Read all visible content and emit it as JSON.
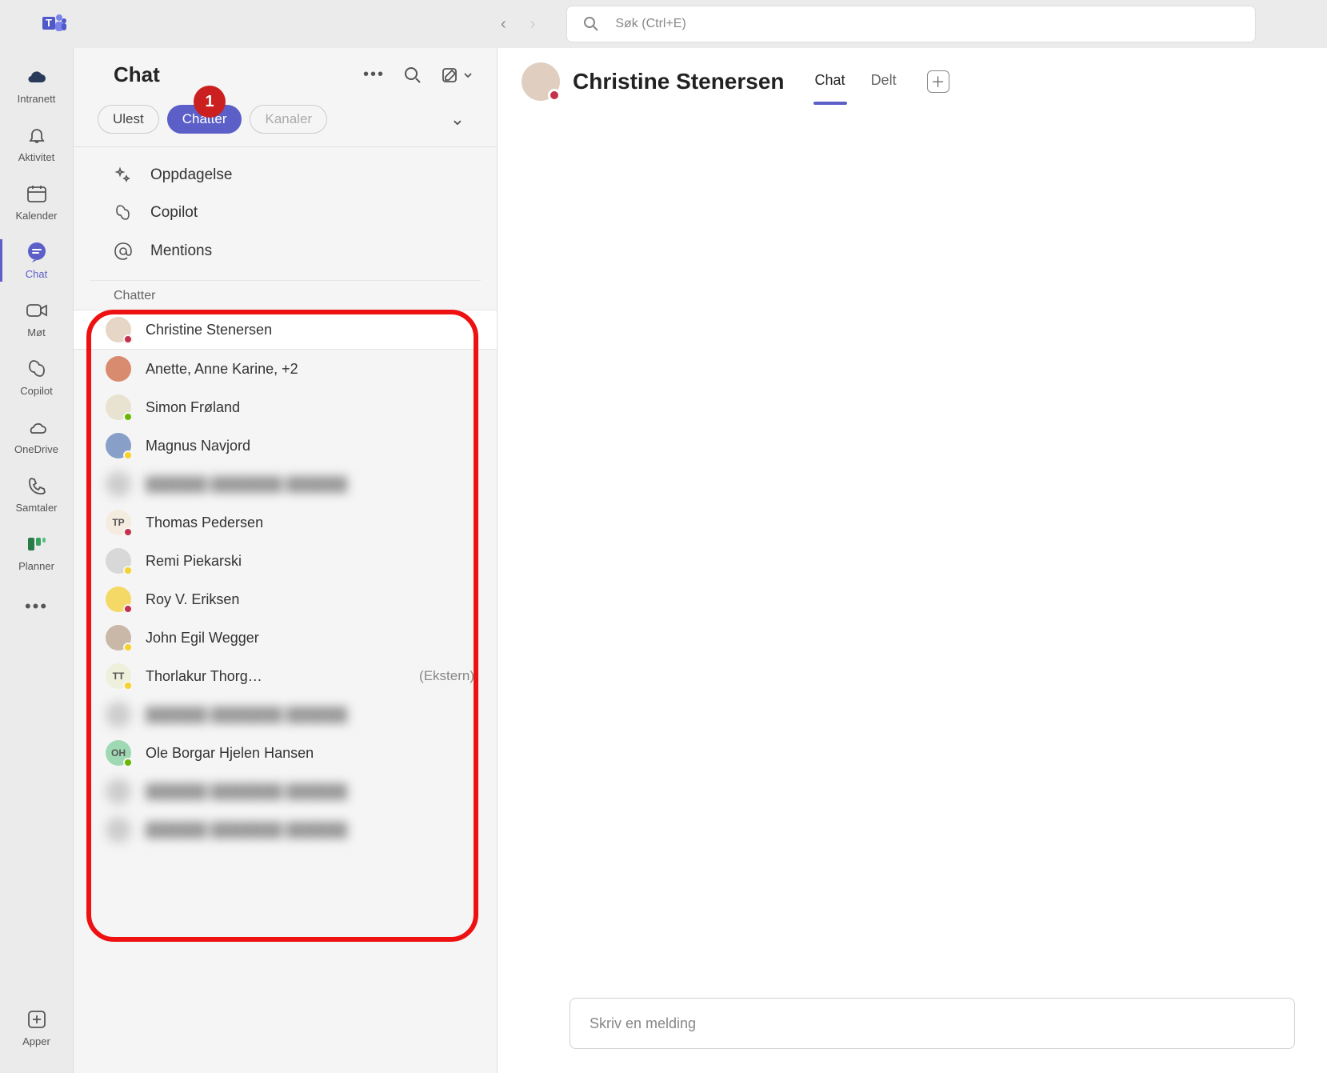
{
  "topbar": {
    "search_placeholder": "Søk (Ctrl+E)"
  },
  "rail": {
    "items": [
      {
        "label": "Intranett",
        "icon": "cloud-dark"
      },
      {
        "label": "Aktivitet",
        "icon": "bell"
      },
      {
        "label": "Kalender",
        "icon": "calendar"
      },
      {
        "label": "Chat",
        "icon": "chat",
        "active": true
      },
      {
        "label": "Møt",
        "icon": "video"
      },
      {
        "label": "Copilot",
        "icon": "copilot"
      },
      {
        "label": "OneDrive",
        "icon": "cloud"
      },
      {
        "label": "Samtaler",
        "icon": "phone"
      },
      {
        "label": "Planner",
        "icon": "planner"
      }
    ],
    "apps_label": "Apper"
  },
  "chatpanel": {
    "title": "Chat",
    "filters": {
      "unread": "Ulest",
      "chats": "Chatter",
      "channels": "Kanaler",
      "badge": "1"
    },
    "menu": [
      {
        "label": "Oppdagelse",
        "icon": "sparkle"
      },
      {
        "label": "Copilot",
        "icon": "copilot"
      },
      {
        "label": "Mentions",
        "icon": "at"
      }
    ],
    "section_label": "Chatter",
    "chats": [
      {
        "name": "Christine Stenersen",
        "presence": "busy",
        "selected": true,
        "avatar_bg": "#e5d6c6"
      },
      {
        "name": "Anette, Anne Karine, +2",
        "presence": "",
        "avatar_bg": "#d98b6f"
      },
      {
        "name": "Simon Frøland",
        "presence": "avail",
        "avatar_bg": "#e8e2d0"
      },
      {
        "name": "Magnus Navjord",
        "presence": "away",
        "avatar_bg": "#88a0c8"
      },
      {
        "name": "blurred",
        "blurred": true
      },
      {
        "name": "Thomas Pedersen",
        "presence": "busy",
        "avatar_initials": "TP",
        "avatar_bg": "#f5ece0"
      },
      {
        "name": "Remi Piekarski",
        "presence": "away",
        "avatar_bg": "#d8d8d8"
      },
      {
        "name": "Roy V. Eriksen",
        "presence": "busy",
        "avatar_bg": "#f5d966"
      },
      {
        "name": "John Egil Wegger",
        "presence": "away",
        "avatar_bg": "#c9b8a8"
      },
      {
        "name": "Thorlakur Thorg…",
        "presence": "away",
        "avatar_initials": "TT",
        "avatar_bg": "#eef0dc",
        "external": "(Ekstern)"
      },
      {
        "name": "blurred",
        "blurred": true
      },
      {
        "name": "Ole Borgar Hjelen Hansen",
        "presence": "avail",
        "avatar_initials": "OH",
        "avatar_bg": "#9fd9b3"
      },
      {
        "name": "blurred",
        "blurred": true
      },
      {
        "name": "blurred",
        "blurred": true
      }
    ]
  },
  "main": {
    "person": "Christine Stenersen",
    "tabs": [
      {
        "label": "Chat",
        "active": true
      },
      {
        "label": "Delt"
      }
    ],
    "compose_placeholder": "Skriv en melding"
  }
}
